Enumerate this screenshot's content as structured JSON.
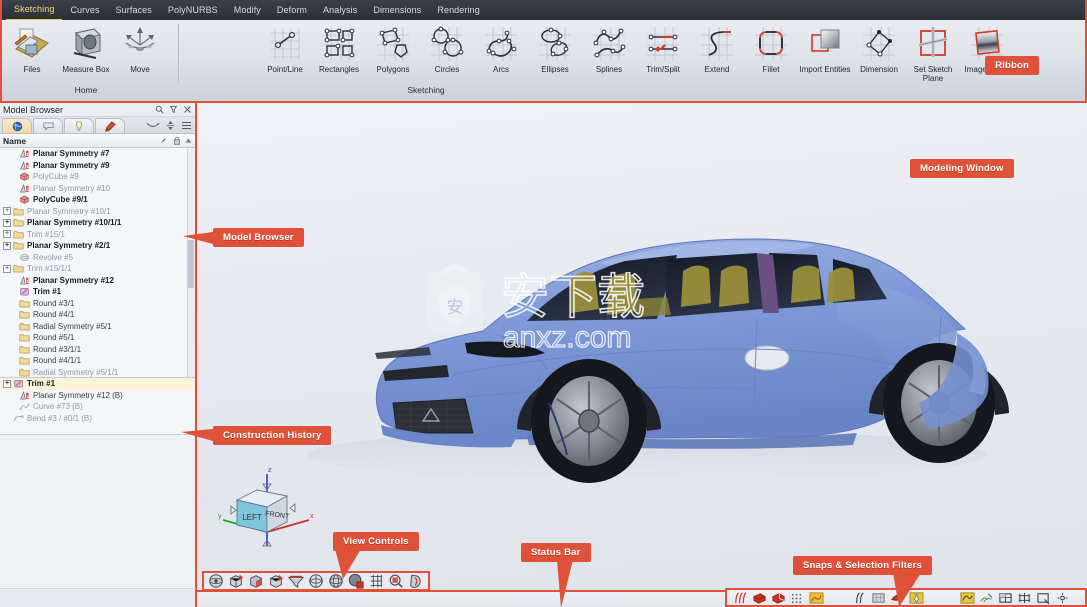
{
  "menubar": {
    "items": [
      {
        "label": "Sketching",
        "active": true
      },
      {
        "label": "Curves",
        "active": false
      },
      {
        "label": "Surfaces",
        "active": false
      },
      {
        "label": "PolyNURBS",
        "active": false
      },
      {
        "label": "Modify",
        "active": false
      },
      {
        "label": "Deform",
        "active": false
      },
      {
        "label": "Analysis",
        "active": false
      },
      {
        "label": "Dimensions",
        "active": false
      },
      {
        "label": "Rendering",
        "active": false
      }
    ]
  },
  "ribbon": {
    "groups": [
      {
        "label": "Home",
        "buttons": [
          {
            "label": "Files",
            "icon": "files-icon"
          },
          {
            "label": "Measure Box",
            "icon": "measure-box-icon"
          },
          {
            "label": "Move",
            "icon": "move-icon"
          }
        ]
      },
      {
        "label": "Sketching",
        "buttons": [
          {
            "label": "Point/Line",
            "icon": "point-line-icon"
          },
          {
            "label": "Rectangles",
            "icon": "rectangles-icon"
          },
          {
            "label": "Polygons",
            "icon": "polygons-icon"
          },
          {
            "label": "Circles",
            "icon": "circles-icon"
          },
          {
            "label": "Arcs",
            "icon": "arcs-icon"
          },
          {
            "label": "Ellipses",
            "icon": "ellipses-icon"
          },
          {
            "label": "Splines",
            "icon": "splines-icon"
          },
          {
            "label": "Trim/Split",
            "icon": "trim-split-icon"
          },
          {
            "label": "Extend",
            "icon": "extend-icon"
          },
          {
            "label": "Fillet",
            "icon": "fillet-icon"
          },
          {
            "label": "Import Entities",
            "icon": "import-entities-icon"
          },
          {
            "label": "Dimension",
            "icon": "dimension-icon"
          },
          {
            "label": "Set Sketch Plane",
            "icon": "set-sketch-plane-icon"
          },
          {
            "label": "Image Plane",
            "icon": "image-plane-icon"
          }
        ]
      }
    ]
  },
  "callouts": {
    "ribbon": "Ribbon",
    "modeling_window": "Modeling Window",
    "model_browser": "Model Browser",
    "construction_history": "Construction History",
    "view_controls": "View Controls",
    "status_bar": "Status Bar",
    "snaps_filters": "Snaps & Selection Filters"
  },
  "model_browser": {
    "title": "Model Browser",
    "title_icons": [
      "search-icon",
      "filter-icon",
      "close-icon"
    ],
    "tabs": [
      {
        "name": "world-tab",
        "selected": true
      },
      {
        "name": "comments-tab",
        "selected": false
      },
      {
        "name": "lights-tab",
        "selected": false
      },
      {
        "name": "materials-tab",
        "selected": false
      }
    ],
    "tab_right_icons": [
      "collapse-icon",
      "sort-icon",
      "menu-icon"
    ],
    "column_header": {
      "name": "Name",
      "icons": [
        "visibility-icon",
        "lock-icon",
        "scroll-up-icon"
      ]
    },
    "tree": [
      {
        "label": "Planar Symmetry #7",
        "icon": "planar-symmetry-icon",
        "bold": true,
        "dim": false,
        "expand": false,
        "indent": 1
      },
      {
        "label": "Planar Symmetry #9",
        "icon": "planar-symmetry-icon",
        "bold": true,
        "dim": false,
        "expand": false,
        "indent": 1
      },
      {
        "label": "PolyCube #9",
        "icon": "polycube-icon",
        "bold": false,
        "dim": true,
        "expand": false,
        "indent": 1
      },
      {
        "label": "Planar Symmetry #10",
        "icon": "planar-symmetry-icon",
        "bold": false,
        "dim": true,
        "expand": false,
        "indent": 1
      },
      {
        "label": "PolyCube #9/1",
        "icon": "polycube-icon",
        "bold": true,
        "dim": false,
        "expand": false,
        "indent": 1
      },
      {
        "label": "Planar Symmetry #10/1",
        "icon": "folder-icon",
        "bold": false,
        "dim": true,
        "expand": true,
        "indent": 0
      },
      {
        "label": "Planar Symmetry #10/1/1",
        "icon": "folder-icon",
        "bold": true,
        "dim": false,
        "expand": true,
        "indent": 0
      },
      {
        "label": "Trim #15/1",
        "icon": "folder-icon",
        "bold": false,
        "dim": true,
        "expand": true,
        "indent": 0
      },
      {
        "label": "Planar Symmetry #2/1",
        "icon": "folder-icon",
        "bold": true,
        "dim": false,
        "expand": true,
        "indent": 0
      },
      {
        "label": "Revolve #5",
        "icon": "revolve-icon",
        "bold": false,
        "dim": true,
        "expand": false,
        "indent": 1
      },
      {
        "label": "Trim #15/1/1",
        "icon": "folder-icon",
        "bold": false,
        "dim": true,
        "expand": true,
        "indent": 0
      },
      {
        "label": "Planar Symmetry #12",
        "icon": "planar-symmetry-icon",
        "bold": true,
        "dim": false,
        "expand": false,
        "indent": 1
      },
      {
        "label": "Trim #1",
        "icon": "trim-icon",
        "bold": true,
        "dim": false,
        "expand": false,
        "indent": 1
      },
      {
        "label": "Round #3/1",
        "icon": "folder-icon",
        "bold": false,
        "dim": false,
        "expand": false,
        "indent": 1
      },
      {
        "label": "Round #4/1",
        "icon": "folder-icon",
        "bold": false,
        "dim": false,
        "expand": false,
        "indent": 1
      },
      {
        "label": "Radial Symmetry #5/1",
        "icon": "folder-icon",
        "bold": false,
        "dim": false,
        "expand": false,
        "indent": 1
      },
      {
        "label": "Round #5/1",
        "icon": "folder-icon",
        "bold": false,
        "dim": false,
        "expand": false,
        "indent": 1
      },
      {
        "label": "Round #3/1/1",
        "icon": "folder-icon",
        "bold": false,
        "dim": false,
        "expand": false,
        "indent": 1
      },
      {
        "label": "Round #4/1/1",
        "icon": "folder-icon",
        "bold": false,
        "dim": false,
        "expand": false,
        "indent": 1
      },
      {
        "label": "Radial Symmetry #5/1/1",
        "icon": "folder-icon",
        "bold": false,
        "dim": true,
        "expand": false,
        "indent": 1
      }
    ]
  },
  "construction_history": {
    "rows": [
      {
        "label": "Trim #1",
        "icon": "trim-icon",
        "selected": true,
        "dim": false,
        "expand": true,
        "indent": 0
      },
      {
        "label": "Planar Symmetry #12 (B)",
        "icon": "planar-symmetry-icon",
        "selected": false,
        "dim": false,
        "expand": false,
        "indent": 1
      },
      {
        "label": "Curve #73 (B)",
        "icon": "curve-icon",
        "selected": false,
        "dim": true,
        "expand": false,
        "indent": 1
      },
      {
        "label": "Bend #3 / #0/1 (B)",
        "icon": "bend-icon",
        "selected": false,
        "dim": true,
        "expand": false,
        "indent": 0
      }
    ]
  },
  "viewport": {
    "view_cube": {
      "face_left": "LEFT",
      "face_front": "FRONT",
      "axis_x": "x",
      "axis_y": "y",
      "axis_z": "z"
    },
    "watermark": {
      "text_cn": "安下载",
      "text_en": "anxz.com",
      "logo": "shield-bag-icon"
    },
    "model": {
      "name": "car-model",
      "body_color": "#7f9ad8",
      "interior_color": "#9a8f3c",
      "glass_color": "#1d2230",
      "wheel_color": "#8f949c"
    }
  },
  "view_controls": {
    "icons": [
      "fit-view-icon",
      "isometric-view-icon",
      "shaded-view-icon",
      "perspective-view-icon",
      "section-view-icon",
      "rotate-view-icon",
      "orbit-view-icon",
      "render-mode-icon",
      "grid-toggle-icon",
      "zoom-window-icon",
      "view-display-icon"
    ]
  },
  "snaps_selection_filters": {
    "groups": [
      [
        "snap-curve-icon",
        "snap-surface-icon",
        "snap-solid-icon",
        "snap-grid-icon",
        "snap-mesh-icon"
      ],
      [
        "filter-curve-icon",
        "filter-face-icon",
        "filter-surface-icon",
        "filter-point-icon"
      ],
      [
        "select-part-icon",
        "select-feature-icon",
        "select-face-icon",
        "select-edge-icon",
        "select-box-icon",
        "select-point-icon"
      ]
    ]
  },
  "colors": {
    "accent_red": "#e0513a",
    "menubar_bg": "#2f343c",
    "menu_active": "#f4d97a",
    "panel_bg": "#eef0f4",
    "viewport_bg": "#e9ecf2"
  }
}
